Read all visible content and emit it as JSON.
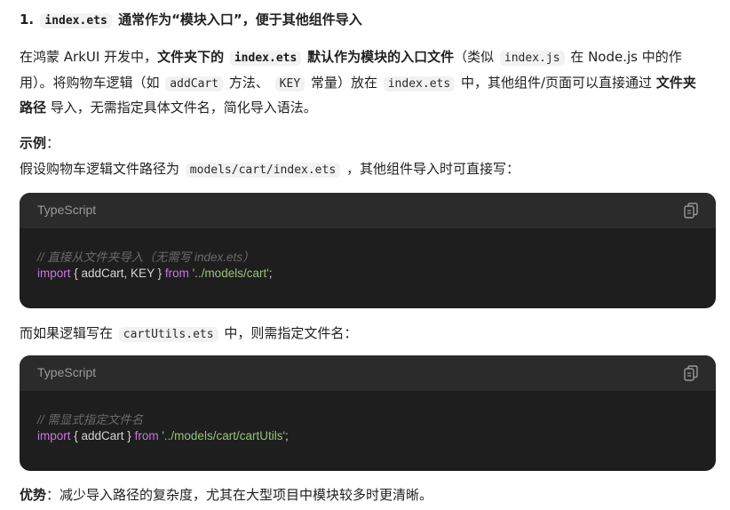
{
  "heading": {
    "number": "1.",
    "code": "index.ets",
    "text": "通常作为“模块入口”，便于其他组件导入"
  },
  "para1": {
    "line1": {
      "t1": "在鸿蒙 ArkUI 开发中，",
      "b1": "文件夹下的",
      "code1": "index.ets",
      "b2": "默认作为模块的入口文件",
      "t2": "（类似",
      "code2": "index.js",
      "t3": "在 Node.js 中的作"
    },
    "line2": {
      "t1": "用）。将购物车逻辑（如",
      "code1": "addCart",
      "t2": "方法、",
      "code2": "KEY",
      "t3": "常量）放在",
      "code3": "index.ets",
      "t4": "中，其他组件/页面可以直接通过",
      "b1": "文件夹"
    },
    "line3": {
      "b1": "路径",
      "t1": "导入，无需指定具体文件名，简化导入语法。"
    }
  },
  "example": {
    "label": "示例",
    "colon": "：",
    "t1": "假设购物车逻辑文件路径为",
    "code1": "models/cart/index.ets",
    "t2": "，其他组件导入时可直接写："
  },
  "code1": {
    "lang": "TypeScript",
    "comment": "// 直接从文件夹导入（无需写 index.ets）",
    "kw_import": "import",
    "body": " { addCart, KEY } ",
    "kw_from": "from",
    "path": "'../models/cart'",
    "end": ";"
  },
  "middle": {
    "t1": "而如果逻辑写在",
    "code1": "cartUtils.ets",
    "t2": "中，则需指定文件名："
  },
  "code2": {
    "lang": "TypeScript",
    "comment": "// 需显式指定文件名",
    "kw_import": "import",
    "body": " { addCart } ",
    "kw_from": "from",
    "path": "'../models/cart/cartUtils'",
    "end": ";"
  },
  "advantage": {
    "label": "优势",
    "t1": "：减少导入路径的复杂度，尤其在大型项目中模块较多时更清晰。"
  },
  "icons": {
    "copy": "copy-icon"
  },
  "colors": {
    "code_bg": "#1e1e1e",
    "code_header": "#2b2b2b",
    "keyword": "#c678dd",
    "string": "#98c379",
    "comment": "#6a6a6a"
  }
}
